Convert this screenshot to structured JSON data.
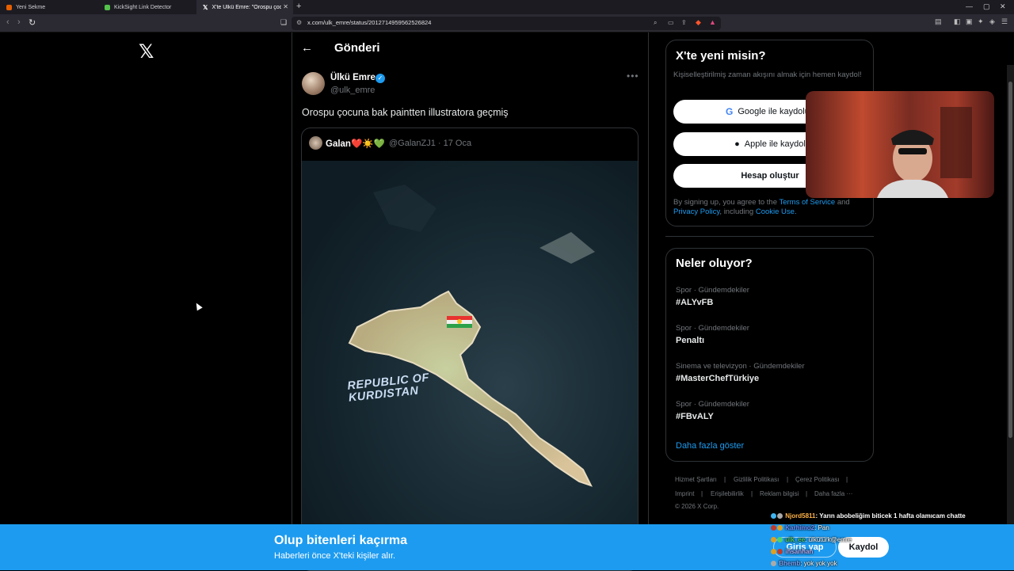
{
  "browser": {
    "tabs": [
      {
        "label": "Yeni Sekme",
        "color": "#e66000"
      },
      {
        "label": "KickSight Link Detector",
        "color": "#53c24a"
      },
      {
        "label": "X'te Ülkü Emre: \"Orospu çocuna",
        "color": "#ffffff"
      }
    ],
    "url": "x.com/ulk_emre/status/2012714959562526824"
  },
  "post": {
    "header_title": "Gönderi",
    "author_name": "Ülkü Emre",
    "author_handle": "@ulk_emre",
    "text": "Orospu çocuna bak paintten illustratora geçmiş",
    "quote": {
      "name": "Galan❤️☀️💚",
      "handle_date": "@GalanZJ1 · 17 Oca",
      "map_text": "REPUBLIC OF KURDISTAN"
    }
  },
  "signup": {
    "title": "X'te yeni misin?",
    "subtitle": "Kişiselleştirilmiş zaman akışını almak için hemen kaydol!",
    "google_label": "Google ile kaydolun",
    "apple_label": "Apple ile kaydol",
    "create_label": "Hesap oluştur",
    "legal_prefix": "By signing up, you agree to the ",
    "terms": "Terms of Service",
    "and": " and ",
    "privacy": "Privacy Policy",
    "including": ", including ",
    "cookie": "Cookie Use."
  },
  "trends": {
    "title": "Neler oluyor?",
    "items": [
      {
        "category": "Spor · Gündemdekiler",
        "name": "#ALYvFB"
      },
      {
        "category": "Spor · Gündemdekiler",
        "name": "Penaltı"
      },
      {
        "category": "Sinema ve televizyon · Gündemdekiler",
        "name": "#MasterChefTürkiye"
      },
      {
        "category": "Spor · Gündemdekiler",
        "name": "#FBvALY"
      }
    ],
    "show_more": "Daha fazla göster"
  },
  "footer": {
    "links": [
      "Hizmet Şartları",
      "Gizlilik Politikası",
      "Çerez Politikası",
      "Imprint",
      "Erişilebilirlik",
      "Reklam bilgisi",
      "Daha fazla ···"
    ],
    "copyright": "© 2026 X Corp."
  },
  "bottom_banner": {
    "title": "Olup bitenleri kaçırma",
    "subtitle": "Haberleri önce X'teki kişiler alır.",
    "login_label": "Giriş yap",
    "signup_label": "Kaydol"
  },
  "chat": [
    {
      "user": "Njord5811",
      "message": ": Yarın abobeliğim biticek 1 hafta olamıcam chatte",
      "color": "#ffb347"
    },
    {
      "user": "Karhimo2",
      "message": ": Pan",
      "color": "#6b8cff"
    },
    {
      "user": "ulk_ee",
      "message": ": ülkütürk@emre",
      "color": "#4fd16b"
    },
    {
      "user": "ihsanhan",
      "message": "",
      "color": "#b0b0ff"
    },
    {
      "user": "Bhemb",
      "message": ": yok yok yok",
      "color": "#7aa6ff"
    }
  ]
}
